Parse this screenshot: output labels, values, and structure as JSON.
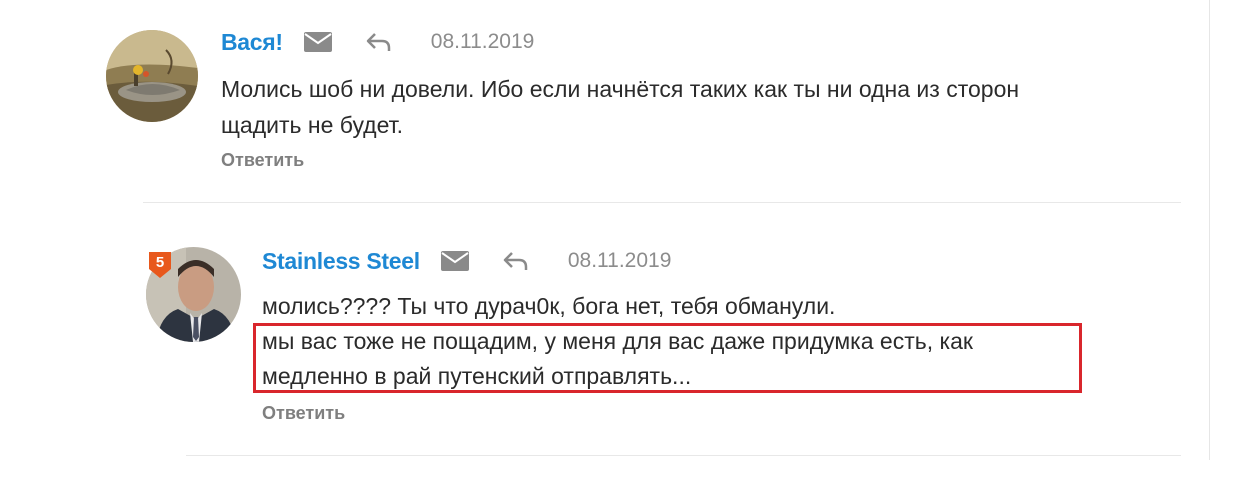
{
  "comments": [
    {
      "author": "Вася!",
      "date": "08.11.2019",
      "lines": [
        "Молись шоб ни довели. Ибо если начнётся таких как ты ни одна из сторон",
        "щадить не будет."
      ],
      "reply_label": "Ответить",
      "avatar": "nature-photo-avatar"
    },
    {
      "author": "Stainless Steel",
      "date": "08.11.2019",
      "badge": "5",
      "lines": [
        "молись???? Ты что дурач0к, бога нет, тебя обманули.",
        "мы вас тоже не пощадим, у меня для вас даже придумка есть, как",
        "медленно в рай путенский отправлять..."
      ],
      "reply_label": "Ответить",
      "avatar": "man-in-suit-avatar",
      "highlighted_lines": [
        2,
        3
      ]
    }
  ],
  "colors": {
    "author": "#1e88d4",
    "date": "#8c8c8c",
    "reply": "#7f7f7f",
    "highlight": "#d9262c",
    "badge": "#e8581c"
  }
}
